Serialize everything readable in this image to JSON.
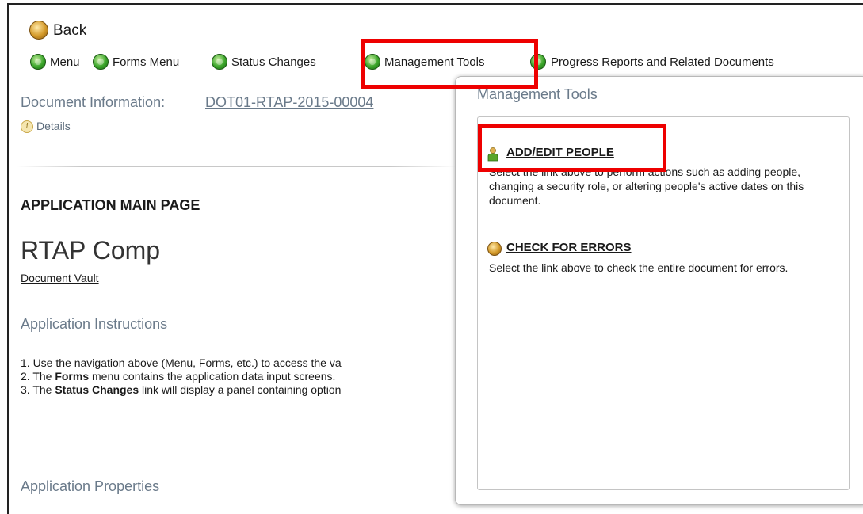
{
  "back_label": "Back",
  "nav": {
    "items": [
      {
        "label": "Menu"
      },
      {
        "label": "Forms Menu"
      },
      {
        "label": "Status Changes"
      },
      {
        "label": "Management Tools"
      },
      {
        "label": "Progress Reports and Related Documents"
      }
    ]
  },
  "document_info": {
    "label": "Document Information:",
    "id": "DOT01-RTAP-2015-00004",
    "details_label": "Details"
  },
  "main": {
    "page_heading": "APPLICATION MAIN PAGE",
    "app_title": "RTAP Comp",
    "document_vault_label": "Document Vault",
    "instructions_heading": "Application Instructions",
    "instructions": [
      {
        "prefix": "1. Use the navigation above (Menu, Forms, etc.) to access the va",
        "bold": "",
        "suffix": ""
      },
      {
        "prefix": "2. The ",
        "bold": "Forms",
        "suffix": " menu contains the application data input screens."
      },
      {
        "prefix": "3. The ",
        "bold": "Status Changes",
        "suffix": " link will display a panel containing option"
      }
    ],
    "properties_heading": "Application Properties"
  },
  "panel": {
    "title": "Management Tools",
    "add_edit": {
      "label": "ADD/EDIT PEOPLE",
      "description": "Select the link above to perform actions such as adding people, changing a security role, or altering people's active dates on this document."
    },
    "check_errors": {
      "label": "CHECK FOR ERRORS",
      "description": "Select the link above to check the entire document for errors."
    }
  },
  "colors": {
    "highlight": "#ee0000",
    "muted_heading": "#6a7a8a",
    "orb_green": "#3aa52a",
    "orb_gold": "#d49a2a"
  }
}
